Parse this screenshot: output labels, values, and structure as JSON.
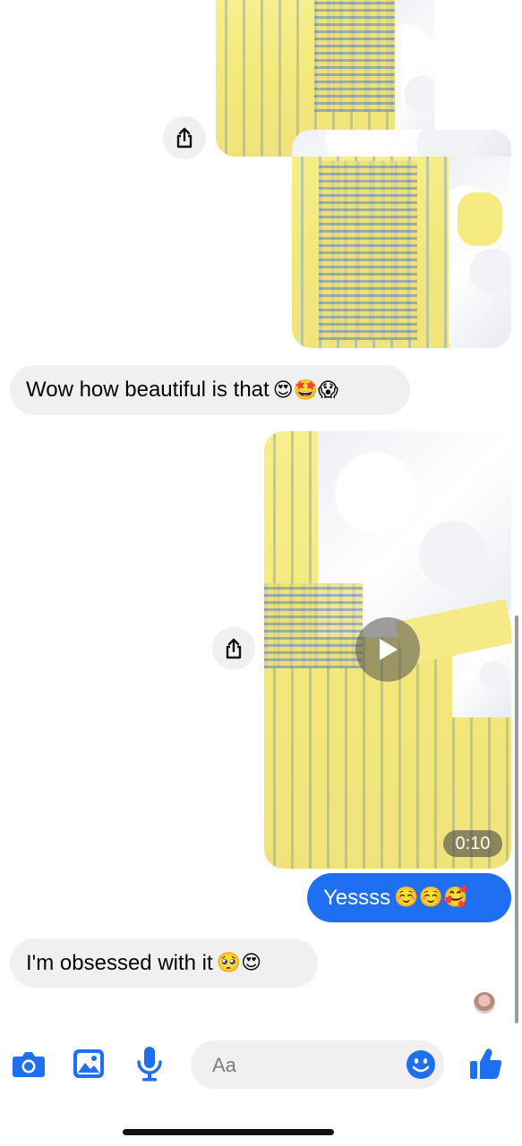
{
  "messages": {
    "incoming_1": {
      "text": "Wow how beautiful is that",
      "emojis": "😍🤩😱"
    },
    "outgoing_1": {
      "text": "Yessss",
      "emojis": "☺️☺️🥰"
    },
    "incoming_2": {
      "text": "I'm obsessed with it",
      "emojis": "🥺😍"
    }
  },
  "video": {
    "duration": "0:10"
  },
  "composer": {
    "placeholder": "Aa"
  },
  "colors": {
    "accent": "#1e6ff2",
    "bubble_in": "#f0f0f0"
  },
  "icons": {
    "share": "share-icon",
    "camera": "camera-icon",
    "gallery": "gallery-icon",
    "mic": "microphone-icon",
    "emoji": "emoji-icon",
    "like": "thumbs-up-icon",
    "play": "play-icon"
  }
}
